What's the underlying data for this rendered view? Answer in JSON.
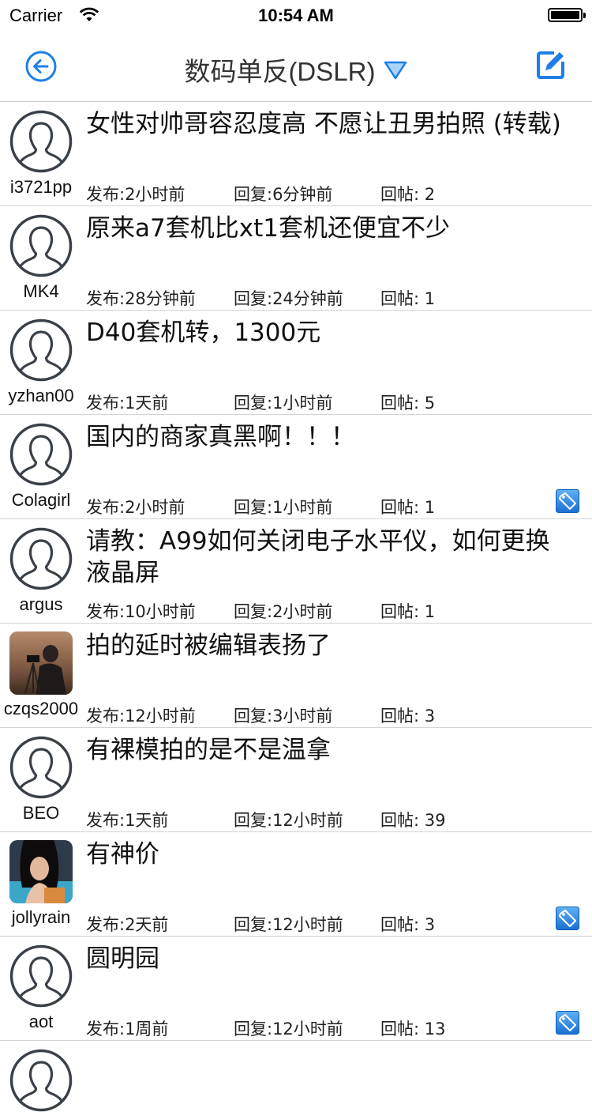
{
  "status_bar": {
    "carrier": "Carrier",
    "time": "10:54 AM"
  },
  "nav": {
    "title": "数码单反(DSLR)"
  },
  "colors": {
    "accent": "#1e7fe6",
    "avatar_line": "#3a4048"
  },
  "threads": [
    {
      "user": "i3721pp",
      "avatar": "default",
      "title": "女性对帅哥容忍度高 不愿让丑男拍照 (转载)",
      "posted": "发布:2小时前",
      "replied": "回复:6分钟前",
      "replies": "回帖: 2",
      "tag": false
    },
    {
      "user": "MK4",
      "avatar": "default",
      "title": " 原来a7套机比xt1套机还便宜不少",
      "posted": "发布:28分钟前",
      "replied": "回复:24分钟前",
      "replies": "回帖: 1",
      "tag": false
    },
    {
      "user": "yzhan00",
      "avatar": "default",
      "title": "D40套机转，1300元",
      "posted": "发布:1天前",
      "replied": "回复:1小时前",
      "replies": "回帖: 5",
      "tag": false
    },
    {
      "user": "Colagirl",
      "avatar": "default",
      "title": "国内的商家真黑啊！！！",
      "posted": "发布:2小时前",
      "replied": "回复:1小时前",
      "replies": "回帖: 1",
      "tag": true
    },
    {
      "user": "argus",
      "avatar": "default",
      "title": "请教：A99如何关闭电子水平仪，如何更换液晶屏",
      "posted": "发布:10小时前",
      "replied": "回复:2小时前",
      "replies": "回帖: 1",
      "tag": false
    },
    {
      "user": "czqs2000",
      "avatar": "photo-photographer",
      "title": "拍的延时被编辑表扬了",
      "posted": "发布:12小时前",
      "replied": "回复:3小时前",
      "replies": "回帖: 3",
      "tag": false
    },
    {
      "user": "BEO",
      "avatar": "default",
      "title": "有裸模拍的是不是温拿",
      "posted": "发布:1天前",
      "replied": "回复:12小时前",
      "replies": "回帖: 39",
      "tag": false
    },
    {
      "user": "jollyrain",
      "avatar": "photo-woman",
      "title": "有神价",
      "posted": "发布:2天前",
      "replied": "回复:12小时前",
      "replies": "回帖: 3",
      "tag": true
    },
    {
      "user": "aot",
      "avatar": "default",
      "title": "圆明园",
      "posted": "发布:1周前",
      "replied": "回复:12小时前",
      "replies": "回帖: 13",
      "tag": true
    }
  ]
}
